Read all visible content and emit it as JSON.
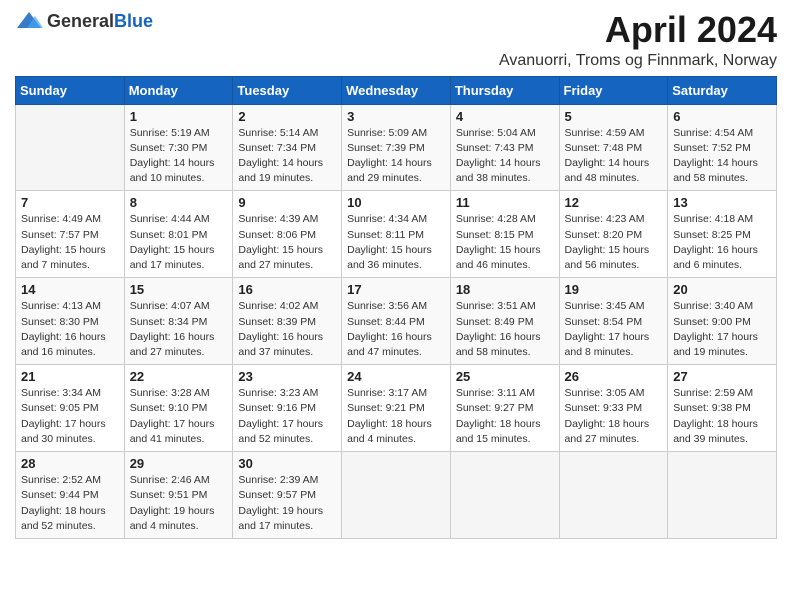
{
  "logo": {
    "text_general": "General",
    "text_blue": "Blue"
  },
  "title": "April 2024",
  "subtitle": "Avanuorri, Troms og Finnmark, Norway",
  "days_of_week": [
    "Sunday",
    "Monday",
    "Tuesday",
    "Wednesday",
    "Thursday",
    "Friday",
    "Saturday"
  ],
  "weeks": [
    [
      {
        "day": "",
        "info": ""
      },
      {
        "day": "1",
        "info": "Sunrise: 5:19 AM\nSunset: 7:30 PM\nDaylight: 14 hours\nand 10 minutes."
      },
      {
        "day": "2",
        "info": "Sunrise: 5:14 AM\nSunset: 7:34 PM\nDaylight: 14 hours\nand 19 minutes."
      },
      {
        "day": "3",
        "info": "Sunrise: 5:09 AM\nSunset: 7:39 PM\nDaylight: 14 hours\nand 29 minutes."
      },
      {
        "day": "4",
        "info": "Sunrise: 5:04 AM\nSunset: 7:43 PM\nDaylight: 14 hours\nand 38 minutes."
      },
      {
        "day": "5",
        "info": "Sunrise: 4:59 AM\nSunset: 7:48 PM\nDaylight: 14 hours\nand 48 minutes."
      },
      {
        "day": "6",
        "info": "Sunrise: 4:54 AM\nSunset: 7:52 PM\nDaylight: 14 hours\nand 58 minutes."
      }
    ],
    [
      {
        "day": "7",
        "info": "Sunrise: 4:49 AM\nSunset: 7:57 PM\nDaylight: 15 hours\nand 7 minutes."
      },
      {
        "day": "8",
        "info": "Sunrise: 4:44 AM\nSunset: 8:01 PM\nDaylight: 15 hours\nand 17 minutes."
      },
      {
        "day": "9",
        "info": "Sunrise: 4:39 AM\nSunset: 8:06 PM\nDaylight: 15 hours\nand 27 minutes."
      },
      {
        "day": "10",
        "info": "Sunrise: 4:34 AM\nSunset: 8:11 PM\nDaylight: 15 hours\nand 36 minutes."
      },
      {
        "day": "11",
        "info": "Sunrise: 4:28 AM\nSunset: 8:15 PM\nDaylight: 15 hours\nand 46 minutes."
      },
      {
        "day": "12",
        "info": "Sunrise: 4:23 AM\nSunset: 8:20 PM\nDaylight: 15 hours\nand 56 minutes."
      },
      {
        "day": "13",
        "info": "Sunrise: 4:18 AM\nSunset: 8:25 PM\nDaylight: 16 hours\nand 6 minutes."
      }
    ],
    [
      {
        "day": "14",
        "info": "Sunrise: 4:13 AM\nSunset: 8:30 PM\nDaylight: 16 hours\nand 16 minutes."
      },
      {
        "day": "15",
        "info": "Sunrise: 4:07 AM\nSunset: 8:34 PM\nDaylight: 16 hours\nand 27 minutes."
      },
      {
        "day": "16",
        "info": "Sunrise: 4:02 AM\nSunset: 8:39 PM\nDaylight: 16 hours\nand 37 minutes."
      },
      {
        "day": "17",
        "info": "Sunrise: 3:56 AM\nSunset: 8:44 PM\nDaylight: 16 hours\nand 47 minutes."
      },
      {
        "day": "18",
        "info": "Sunrise: 3:51 AM\nSunset: 8:49 PM\nDaylight: 16 hours\nand 58 minutes."
      },
      {
        "day": "19",
        "info": "Sunrise: 3:45 AM\nSunset: 8:54 PM\nDaylight: 17 hours\nand 8 minutes."
      },
      {
        "day": "20",
        "info": "Sunrise: 3:40 AM\nSunset: 9:00 PM\nDaylight: 17 hours\nand 19 minutes."
      }
    ],
    [
      {
        "day": "21",
        "info": "Sunrise: 3:34 AM\nSunset: 9:05 PM\nDaylight: 17 hours\nand 30 minutes."
      },
      {
        "day": "22",
        "info": "Sunrise: 3:28 AM\nSunset: 9:10 PM\nDaylight: 17 hours\nand 41 minutes."
      },
      {
        "day": "23",
        "info": "Sunrise: 3:23 AM\nSunset: 9:16 PM\nDaylight: 17 hours\nand 52 minutes."
      },
      {
        "day": "24",
        "info": "Sunrise: 3:17 AM\nSunset: 9:21 PM\nDaylight: 18 hours\nand 4 minutes."
      },
      {
        "day": "25",
        "info": "Sunrise: 3:11 AM\nSunset: 9:27 PM\nDaylight: 18 hours\nand 15 minutes."
      },
      {
        "day": "26",
        "info": "Sunrise: 3:05 AM\nSunset: 9:33 PM\nDaylight: 18 hours\nand 27 minutes."
      },
      {
        "day": "27",
        "info": "Sunrise: 2:59 AM\nSunset: 9:38 PM\nDaylight: 18 hours\nand 39 minutes."
      }
    ],
    [
      {
        "day": "28",
        "info": "Sunrise: 2:52 AM\nSunset: 9:44 PM\nDaylight: 18 hours\nand 52 minutes."
      },
      {
        "day": "29",
        "info": "Sunrise: 2:46 AM\nSunset: 9:51 PM\nDaylight: 19 hours\nand 4 minutes."
      },
      {
        "day": "30",
        "info": "Sunrise: 2:39 AM\nSunset: 9:57 PM\nDaylight: 19 hours\nand 17 minutes."
      },
      {
        "day": "",
        "info": ""
      },
      {
        "day": "",
        "info": ""
      },
      {
        "day": "",
        "info": ""
      },
      {
        "day": "",
        "info": ""
      }
    ]
  ]
}
